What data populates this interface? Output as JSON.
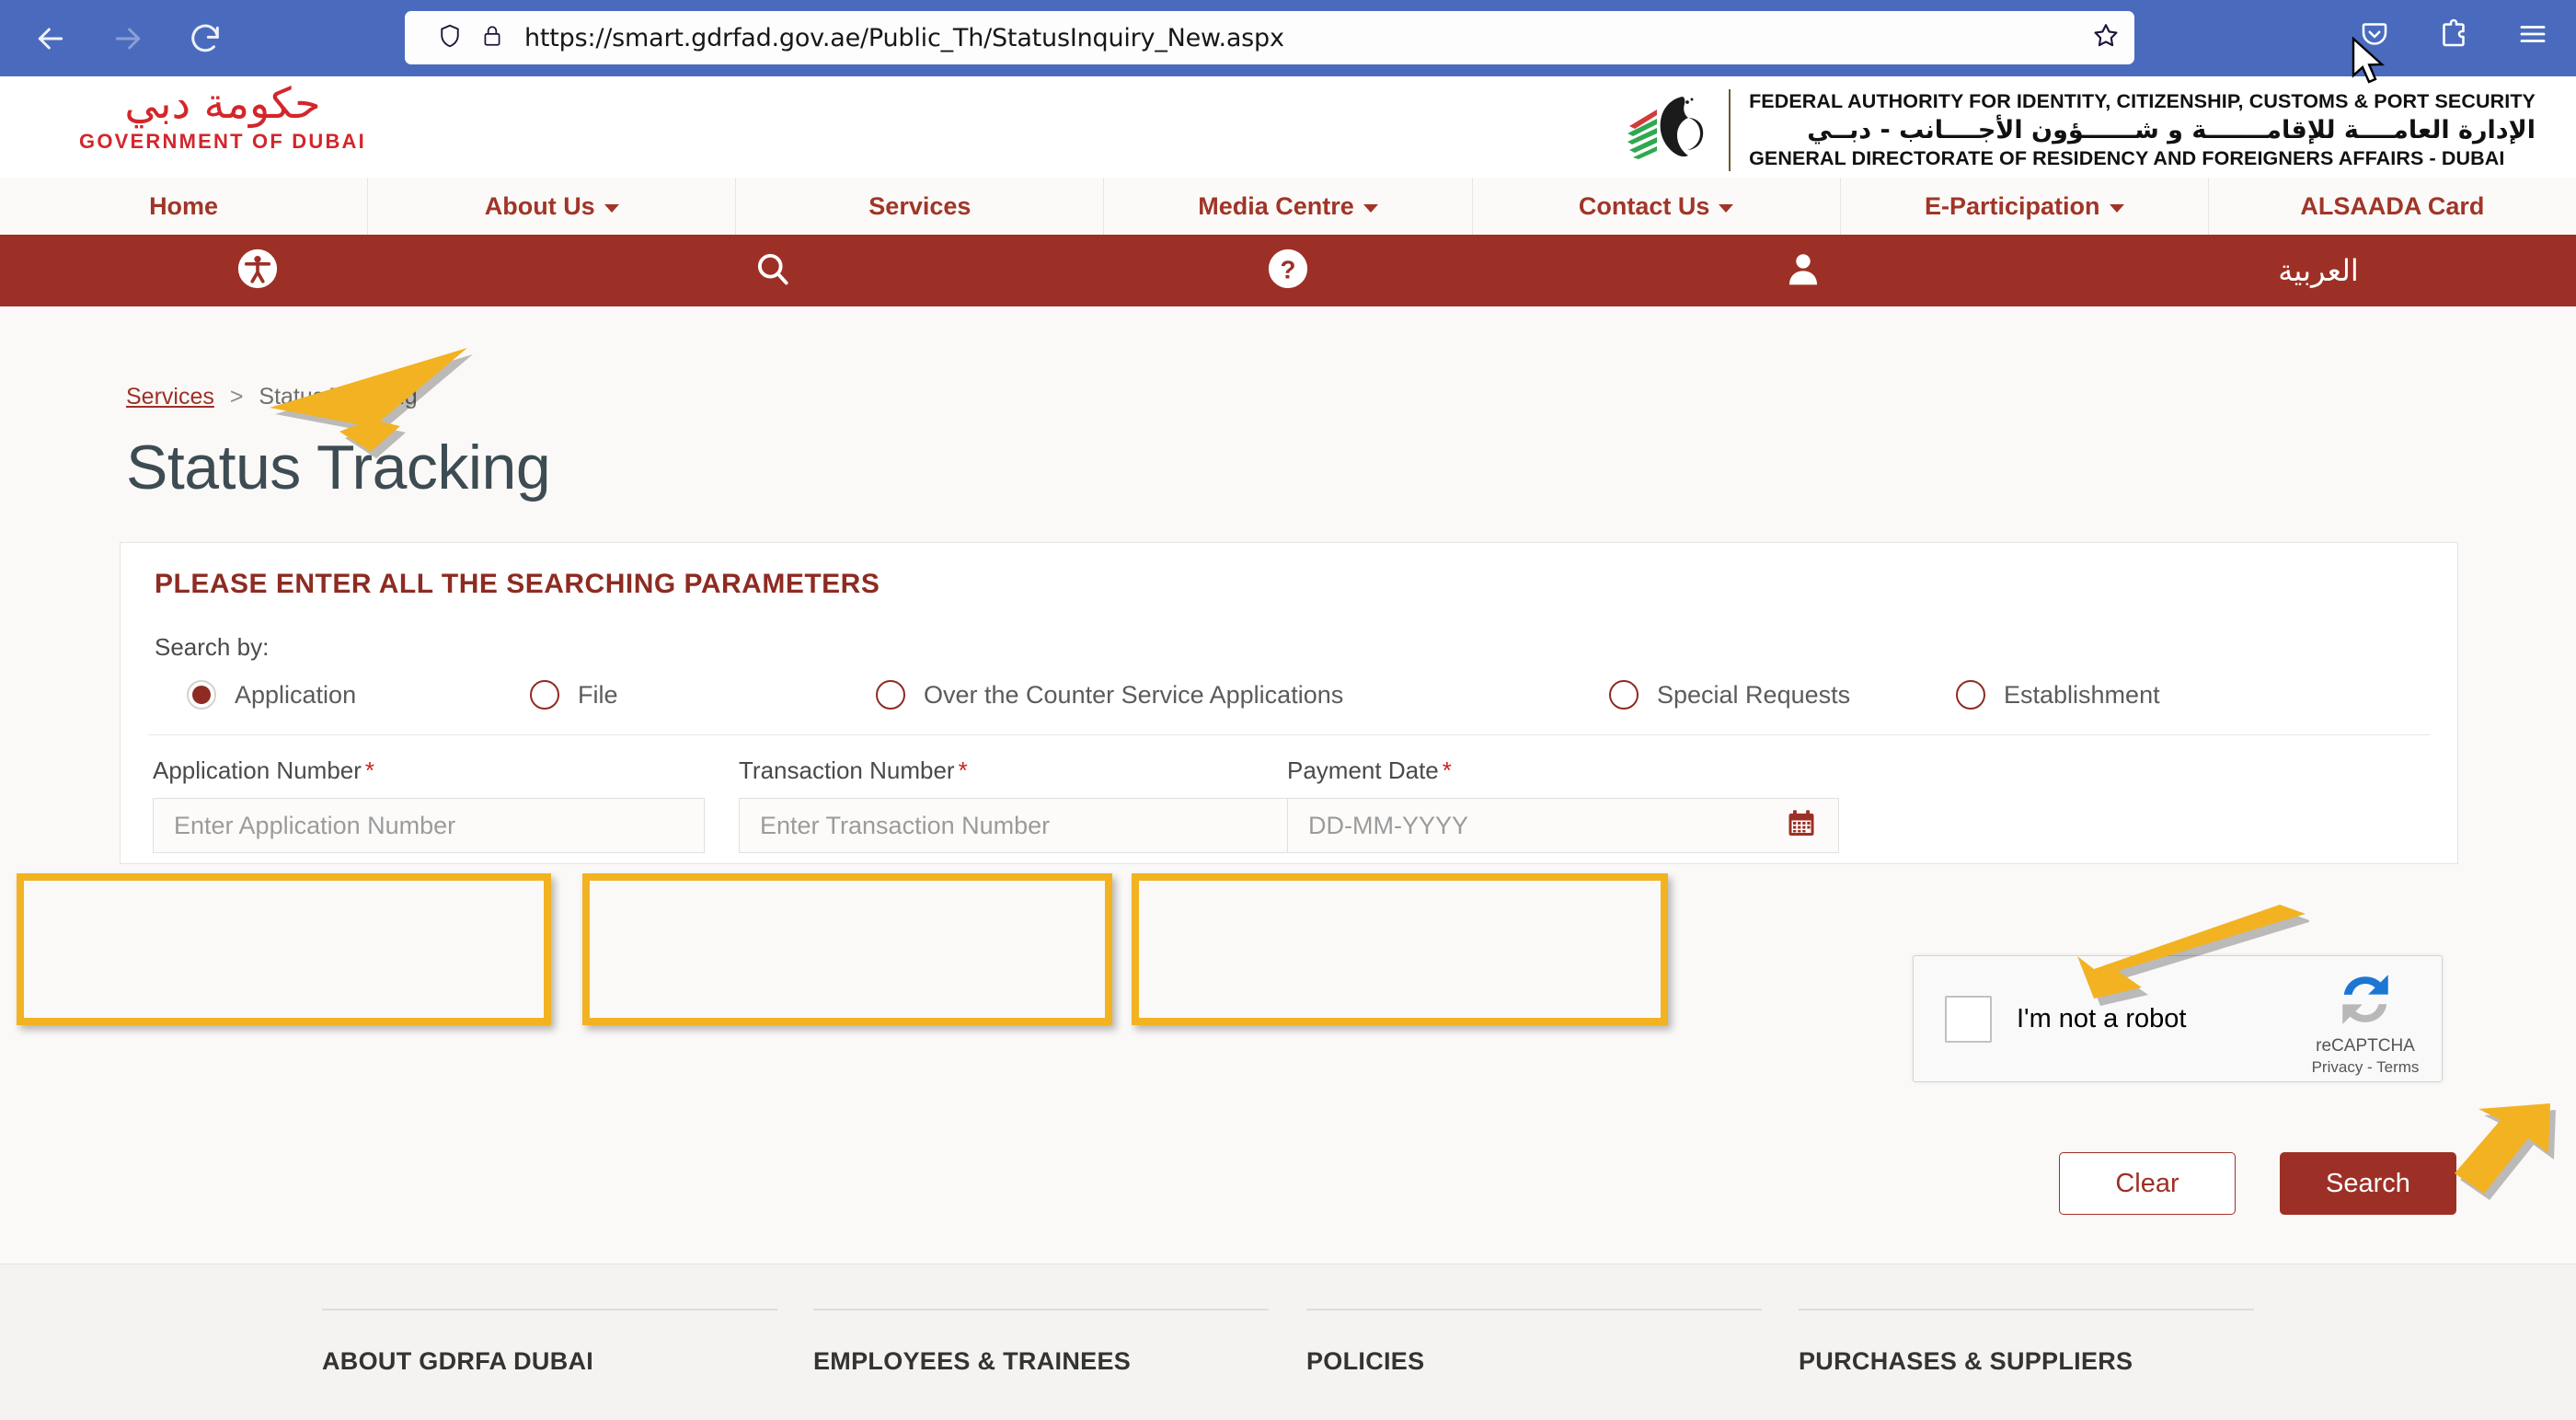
{
  "browser": {
    "url": "https://smart.gdrfad.gov.ae/Public_Th/StatusInquiry_New.aspx",
    "back_label": "Back",
    "forward_label": "Forward",
    "reload_label": "Reload",
    "icons": {
      "shield": "shield-icon",
      "lock": "lock-icon",
      "bookmark": "star-icon",
      "pocket": "pocket-icon",
      "extensions": "extensions-icon",
      "menu": "hamburger-menu-icon"
    }
  },
  "header": {
    "dubai_logo_arabic": "حكومة دبي",
    "dubai_logo_english": "GOVERNMENT OF DUBAI",
    "gdrfa_line1": "FEDERAL AUTHORITY FOR IDENTITY, CITIZENSHIP, CUSTOMS & PORT SECURITY",
    "gdrfa_line2": "الإدارة العامــــة للإقامـــــــة و شــــــؤون الأجــــانب - دبــي",
    "gdrfa_line3": "GENERAL DIRECTORATE OF RESIDENCY AND FOREIGNERS AFFAIRS - DUBAI"
  },
  "nav": {
    "items": [
      {
        "label": "Home",
        "has_caret": false
      },
      {
        "label": "About Us",
        "has_caret": true
      },
      {
        "label": "Services",
        "has_caret": false
      },
      {
        "label": "Media Centre",
        "has_caret": true
      },
      {
        "label": "Contact Us",
        "has_caret": true
      },
      {
        "label": "E-Participation",
        "has_caret": true
      },
      {
        "label": "ALSAADA Card",
        "has_caret": false
      }
    ]
  },
  "icon_bar": {
    "accessibility": "accessibility-icon",
    "search": "search-icon",
    "help": "question-mark-icon",
    "user": "user-account-icon",
    "arabic_label": "العربية"
  },
  "breadcrumb": {
    "parent": "Services",
    "separator": ">",
    "current": "Status Tracking"
  },
  "page": {
    "title": "Status Tracking"
  },
  "form": {
    "heading": "PLEASE ENTER ALL THE SEARCHING PARAMETERS",
    "search_by_label": "Search by:",
    "radio_options": [
      {
        "label": "Application",
        "selected": true
      },
      {
        "label": "File",
        "selected": false
      },
      {
        "label": "Over the Counter Service Applications",
        "selected": false
      },
      {
        "label": "Special Requests",
        "selected": false
      },
      {
        "label": "Establishment",
        "selected": false
      }
    ],
    "fields": [
      {
        "label": "Application Number",
        "required_mark": "*",
        "placeholder": "Enter Application Number",
        "value": "",
        "highlighted": true
      },
      {
        "label": "Transaction Number",
        "required_mark": "*",
        "placeholder": "Enter Transaction Number",
        "value": "",
        "highlighted": true
      },
      {
        "label": "Payment Date",
        "required_mark": "*",
        "placeholder": "DD-MM-YYYY",
        "value": "",
        "highlighted": true,
        "icon": "calendar-icon"
      }
    ]
  },
  "recaptcha": {
    "label": "I'm not a robot",
    "brand": "reCAPTCHA",
    "terms": "Privacy - Terms",
    "checked": false
  },
  "buttons": {
    "clear": "Clear",
    "search": "Search"
  },
  "footer": {
    "columns": [
      {
        "title": "ABOUT GDRFA DUBAI"
      },
      {
        "title": "EMPLOYEES & TRAINEES"
      },
      {
        "title": "POLICIES"
      },
      {
        "title": "PURCHASES & SUPPLIERS"
      }
    ]
  },
  "colors": {
    "brand_red": "#9d3026",
    "dubai_red": "#d3262b",
    "nav_red": "#a03528",
    "highlight_yellow": "#f2b222",
    "browser_blue": "#4a6bbd",
    "title_slate": "#3d4c52"
  },
  "annotations": {
    "arrow_application_radio": "arrow-pointing-to-application-radio",
    "arrow_recaptcha": "arrow-pointing-to-recaptcha",
    "arrow_search_button": "arrow-pointing-to-search-button"
  }
}
